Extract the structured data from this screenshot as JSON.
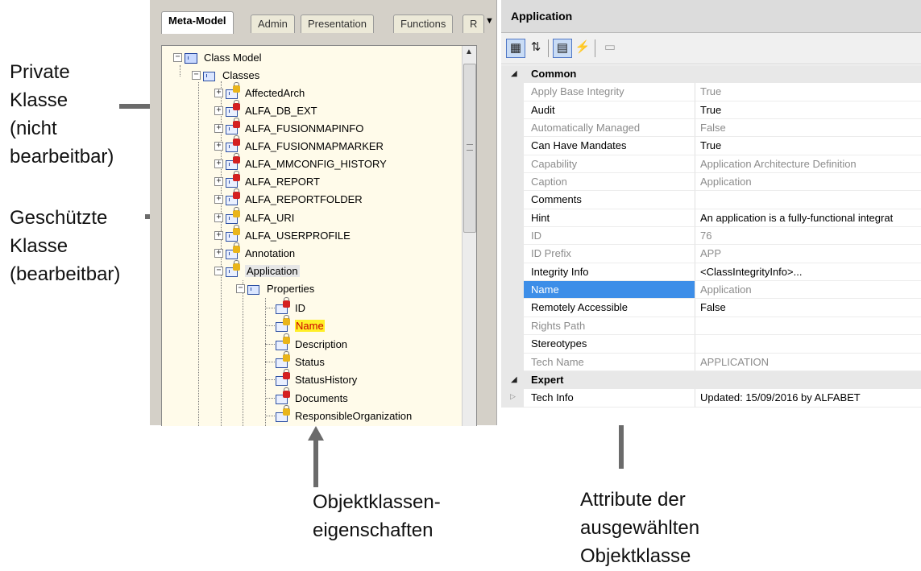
{
  "annotations": {
    "private": [
      "Private",
      "Klasse",
      "(nicht",
      "bearbeitbar)"
    ],
    "protected": [
      "Geschützte",
      "Klasse",
      "(bearbeitbar)"
    ],
    "properties": [
      "Objektklassen-",
      "eigenschaften"
    ],
    "attributes": [
      "Attribute der",
      "ausgewählten",
      "Objektklasse"
    ]
  },
  "tabs": [
    "Meta-Model",
    "Admin",
    "Presentation",
    "Functions",
    "R"
  ],
  "tabs_more": "▼",
  "tree": {
    "root": "Class Model",
    "classes_folder": "Classes",
    "classes": [
      {
        "label": "AffectedArch",
        "lock": "yellow"
      },
      {
        "label": "ALFA_DB_EXT",
        "lock": "red"
      },
      {
        "label": "ALFA_FUSIONMAPINFO",
        "lock": "red"
      },
      {
        "label": "ALFA_FUSIONMAPMARKER",
        "lock": "red"
      },
      {
        "label": "ALFA_MMCONFIG_HISTORY",
        "lock": "red"
      },
      {
        "label": "ALFA_REPORT",
        "lock": "red"
      },
      {
        "label": "ALFA_REPORTFOLDER",
        "lock": "red"
      },
      {
        "label": "ALFA_URI",
        "lock": "yellow"
      },
      {
        "label": "ALFA_USERPROFILE",
        "lock": "yellow"
      },
      {
        "label": "Annotation",
        "lock": "yellow"
      },
      {
        "label": "Application",
        "lock": "yellow"
      }
    ],
    "properties_folder": "Properties",
    "properties": [
      {
        "label": "ID",
        "lock": "red"
      },
      {
        "label": "Name",
        "lock": "yellow"
      },
      {
        "label": "Description",
        "lock": "yellow"
      },
      {
        "label": "Status",
        "lock": "yellow"
      },
      {
        "label": "StatusHistory",
        "lock": "red"
      },
      {
        "label": "Documents",
        "lock": "red"
      },
      {
        "label": "ResponsibleOrganization",
        "lock": "yellow"
      }
    ]
  },
  "properties_panel": {
    "title": "Application",
    "categories": [
      {
        "name": "Common",
        "rows": [
          {
            "name": "Apply Base Integrity",
            "value": "True",
            "editable": false
          },
          {
            "name": "Audit",
            "value": "True",
            "editable": true
          },
          {
            "name": "Automatically Managed",
            "value": "False",
            "editable": false
          },
          {
            "name": "Can Have Mandates",
            "value": "True",
            "editable": true
          },
          {
            "name": "Capability",
            "value": "Application Architecture Definition",
            "editable": false
          },
          {
            "name": "Caption",
            "value": "Application",
            "editable": false
          },
          {
            "name": "Comments",
            "value": "",
            "editable": true
          },
          {
            "name": "Hint",
            "value": "An application is a fully-functional integrat",
            "editable": true
          },
          {
            "name": "ID",
            "value": "76",
            "editable": false
          },
          {
            "name": "ID Prefix",
            "value": "APP",
            "editable": false
          },
          {
            "name": "Integrity Info",
            "value": "<ClassIntegrityInfo>...",
            "editable": true
          },
          {
            "name": "Name",
            "value": "Application",
            "editable": false,
            "selected": true
          },
          {
            "name": "Remotely Accessible",
            "value": "False",
            "editable": true
          },
          {
            "name": "Rights Path",
            "value": "",
            "editable": false
          },
          {
            "name": "Stereotypes",
            "value": "",
            "editable": true
          },
          {
            "name": "Tech Name",
            "value": "APPLICATION",
            "editable": false
          }
        ]
      },
      {
        "name": "Expert",
        "rows": [
          {
            "name": "Tech Info",
            "value": "Updated: 15/09/2016 by ALFABET",
            "editable": true,
            "expandable": true
          }
        ]
      }
    ]
  },
  "colors": {
    "selection": "#3d8ee8",
    "lock_red": "#d42020",
    "lock_yellow": "#e9b51a",
    "highlight": "#ffef27"
  }
}
